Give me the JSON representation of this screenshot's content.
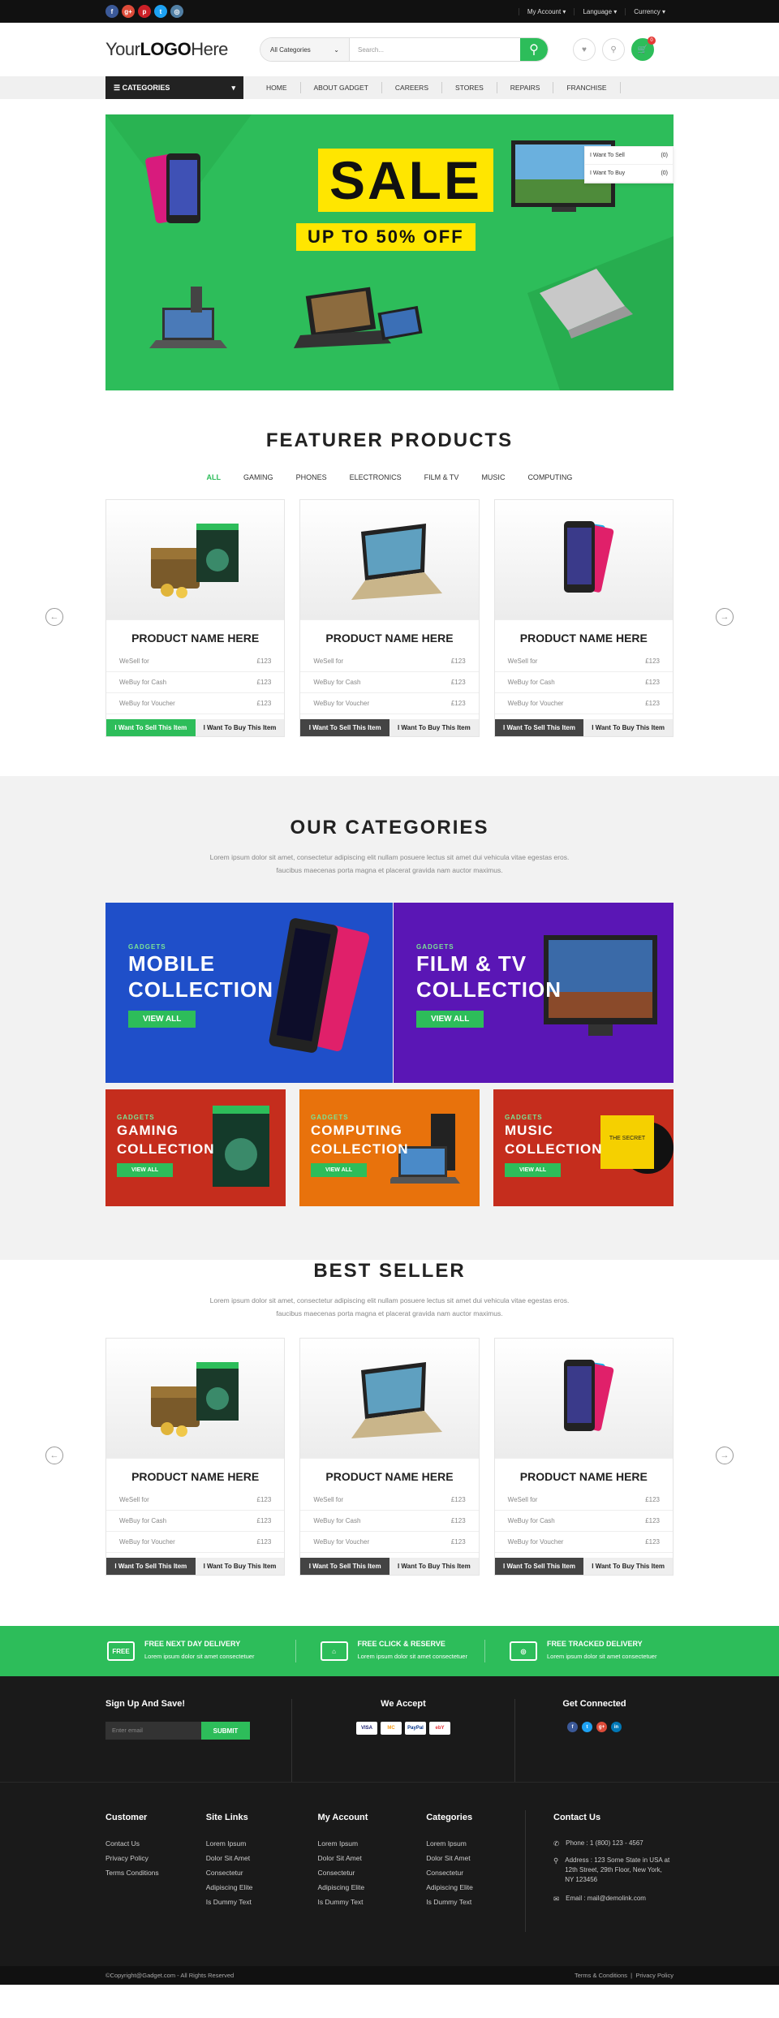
{
  "topbar": {
    "menu": [
      "My Account",
      "Language",
      "Currency"
    ],
    "social": [
      {
        "name": "facebook-icon",
        "glyph": "f",
        "color": "#3b5998"
      },
      {
        "name": "google-plus-icon",
        "glyph": "g+",
        "color": "#dd4b39"
      },
      {
        "name": "pinterest-icon",
        "glyph": "p",
        "color": "#cb2027"
      },
      {
        "name": "twitter-icon",
        "glyph": "t",
        "color": "#1da1f2"
      },
      {
        "name": "instagram-icon",
        "glyph": "◎",
        "color": "#517fa4"
      }
    ]
  },
  "header": {
    "logo_pre": "Your",
    "logo_main": "LOGO",
    "logo_post": "Here",
    "category_select": "All Categories",
    "search_placeholder": "Search...",
    "cart_count": "0"
  },
  "dropdown": [
    {
      "label": "I Want To Sell",
      "count": "(0)"
    },
    {
      "label": "I Want To Buy",
      "count": "(0)"
    }
  ],
  "nav": {
    "categories_label": "CATEGORIES",
    "links": [
      "HOME",
      "ABOUT GADGET",
      "CAREERS",
      "STORES",
      "REPAIRS",
      "FRANCHISE"
    ]
  },
  "banner": {
    "sale": "SALE",
    "offer": "UP TO 50% OFF"
  },
  "featured": {
    "title": "FEATURER PRODUCTS",
    "tabs": [
      "ALL",
      "GAMING",
      "PHONES",
      "ELECTRONICS",
      "FILM & TV",
      "MUSIC",
      "COMPUTING"
    ]
  },
  "product": {
    "name": "PRODUCT NAME HERE",
    "lines": [
      {
        "label": "WeSell for",
        "price": "£123"
      },
      {
        "label": "WeBuy for Cash",
        "price": "£123"
      },
      {
        "label": "WeBuy for Voucher",
        "price": "£123"
      }
    ],
    "sell_btn": "I Want To Sell This Item",
    "buy_btn": "I Want To Buy This Item"
  },
  "categories": {
    "title": "OUR CATEGORIES",
    "lorem1": "Lorem ipsum dolor sit amet, consectetur adipiscing elit nullam posuere lectus sit amet dui vehicula vitae egestas eros.",
    "lorem2": "faucibus maecenas porta magna et placerat gravida nam auctor maximus.",
    "gadgets": "GADGETS",
    "view_all": "VIEW ALL",
    "items": [
      {
        "line1": "MOBILE",
        "line2": "COLLECTION",
        "color": "#1f4fc9"
      },
      {
        "line1": "FILM & TV",
        "line2": "COLLECTION",
        "color": "#5a16b5"
      },
      {
        "line1": "GAMING",
        "line2": "COLLECTION",
        "color": "#c52d1d"
      },
      {
        "line1": "COMPUTING",
        "line2": "COLLECTION",
        "color": "#e8720c"
      },
      {
        "line1": "MUSIC",
        "line2": "COLLECTION",
        "color": "#c52d1d"
      }
    ]
  },
  "bestseller": {
    "title": "BEST SELLER"
  },
  "features": [
    {
      "icon": "FREE",
      "title": "FREE NEXT DAY DELIVERY",
      "text": "Lorem ipsum dolor sit amet consectetuer"
    },
    {
      "icon": "⌂",
      "title": "FREE CLICK & RESERVE",
      "text": "Lorem ipsum dolor sit amet consectetuer"
    },
    {
      "icon": "◎",
      "title": "FREE TRACKED DELIVERY",
      "text": "Lorem ipsum dolor sit amet consectetuer"
    }
  ],
  "footer": {
    "signup": "Sign Up And Save!",
    "email_placeholder": "Enter email",
    "submit": "SUBMIT",
    "accept": "We Accept",
    "payments": [
      "VISA",
      "MC",
      "PayPal",
      "ebY"
    ],
    "connect": "Get Connected",
    "cols": [
      {
        "title": "Customer",
        "items": [
          "Contact Us",
          "Privacy Policy",
          "Terms Conditions"
        ]
      },
      {
        "title": "Site Links",
        "items": [
          "Lorem Ipsum",
          "Dolor Sit Amet",
          "Consectetur",
          "Adipiscing Elite",
          "Is Dummy Text"
        ]
      },
      {
        "title": "My Account",
        "items": [
          "Lorem Ipsum",
          "Dolor Sit Amet",
          "Consectetur",
          "Adipiscing Elite",
          "Is Dummy Text"
        ]
      },
      {
        "title": "Categories",
        "items": [
          "Lorem Ipsum",
          "Dolor Sit Amet",
          "Consectetur",
          "Adipiscing Elite",
          "Is Dummy Text"
        ]
      }
    ],
    "contact_title": "Contact Us",
    "phone": "Phone : 1 (800) 123 - 4567",
    "address": "Address : 123 Some State in USA at 12th Street, 29th Floor, New York, NY 123456",
    "email": "Email : mail@demolink.com",
    "copyright": "©Copyright@Gadget.com - All Rights Reserved",
    "terms": "Terms & Conditions",
    "privacy": "Privacy Policy"
  }
}
